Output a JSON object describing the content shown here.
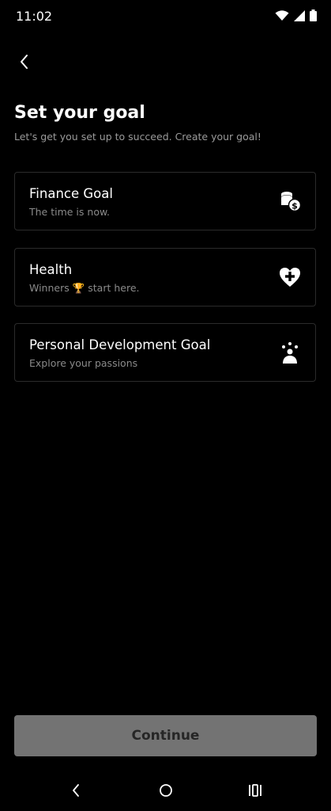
{
  "status_bar": {
    "time": "11:02",
    "icons": [
      "wifi-icon",
      "signal-icon",
      "battery-icon"
    ]
  },
  "header": {
    "back_icon": "chevron-left-icon",
    "title": "Set your goal",
    "subtitle": "Let's get you set up to succeed. Create your goal!"
  },
  "goals": [
    {
      "title": "Finance Goal",
      "subtitle": "The time is now.",
      "icon": "coins-icon"
    },
    {
      "title": "Health",
      "subtitle": "Winners 🏆 start here.",
      "icon": "heart-plus-icon"
    },
    {
      "title": "Personal Development Goal",
      "subtitle": "Explore your passions",
      "icon": "person-sparkle-icon"
    }
  ],
  "continue_label": "Continue",
  "colors": {
    "background": "#000000",
    "card_border": "#2b2b2b",
    "button_bg": "#737373",
    "button_text": "#262626"
  },
  "nav_bar": [
    "back-nav-icon",
    "home-nav-icon",
    "recents-nav-icon"
  ]
}
